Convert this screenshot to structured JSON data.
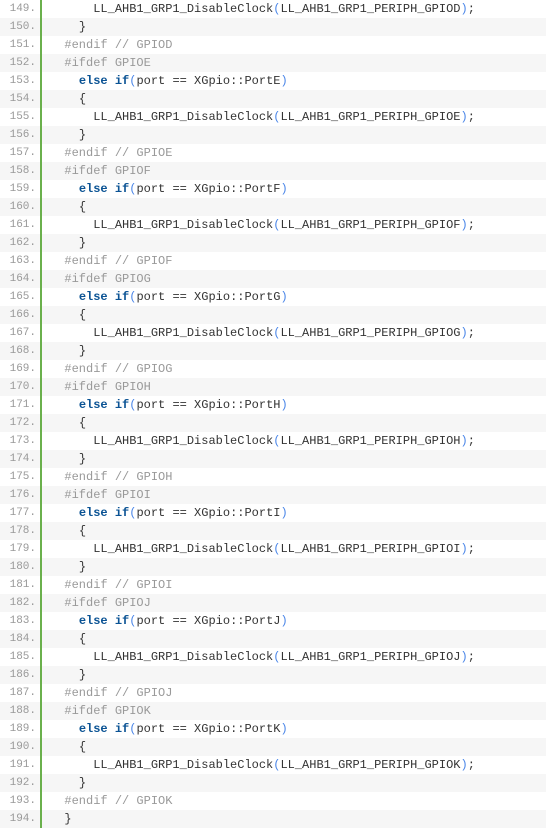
{
  "lines": [
    {
      "num": "149.",
      "indent": "      ",
      "tokens": [
        {
          "t": "func",
          "s": "LL_AHB1_GRP1_DisableClock"
        },
        {
          "t": "paren",
          "s": "("
        },
        {
          "t": "ident",
          "s": "LL_AHB1_GRP1_PERIPH_GPIOD"
        },
        {
          "t": "paren",
          "s": ")"
        },
        {
          "t": "op",
          "s": ";"
        }
      ]
    },
    {
      "num": "150.",
      "indent": "    ",
      "tokens": [
        {
          "t": "brace",
          "s": "}"
        }
      ]
    },
    {
      "num": "151.",
      "indent": "  ",
      "tokens": [
        {
          "t": "preproc",
          "s": "#endif "
        },
        {
          "t": "comment",
          "s": "// GPIOD"
        }
      ]
    },
    {
      "num": "152.",
      "indent": "  ",
      "tokens": [
        {
          "t": "preproc",
          "s": "#ifdef GPIOE"
        }
      ]
    },
    {
      "num": "153.",
      "indent": "    ",
      "tokens": [
        {
          "t": "keyword",
          "s": "else"
        },
        {
          "t": "plain",
          "s": " "
        },
        {
          "t": "keyword",
          "s": "if"
        },
        {
          "t": "paren",
          "s": "("
        },
        {
          "t": "ident",
          "s": "port "
        },
        {
          "t": "op",
          "s": "=="
        },
        {
          "t": "ident",
          "s": " XGpio"
        },
        {
          "t": "op",
          "s": "::"
        },
        {
          "t": "ident",
          "s": "PortE"
        },
        {
          "t": "paren",
          "s": ")"
        }
      ]
    },
    {
      "num": "154.",
      "indent": "    ",
      "tokens": [
        {
          "t": "brace",
          "s": "{"
        }
      ]
    },
    {
      "num": "155.",
      "indent": "      ",
      "tokens": [
        {
          "t": "func",
          "s": "LL_AHB1_GRP1_DisableClock"
        },
        {
          "t": "paren",
          "s": "("
        },
        {
          "t": "ident",
          "s": "LL_AHB1_GRP1_PERIPH_GPIOE"
        },
        {
          "t": "paren",
          "s": ")"
        },
        {
          "t": "op",
          "s": ";"
        }
      ]
    },
    {
      "num": "156.",
      "indent": "    ",
      "tokens": [
        {
          "t": "brace",
          "s": "}"
        }
      ]
    },
    {
      "num": "157.",
      "indent": "  ",
      "tokens": [
        {
          "t": "preproc",
          "s": "#endif "
        },
        {
          "t": "comment",
          "s": "// GPIOE"
        }
      ]
    },
    {
      "num": "158.",
      "indent": "  ",
      "tokens": [
        {
          "t": "preproc",
          "s": "#ifdef GPIOF"
        }
      ]
    },
    {
      "num": "159.",
      "indent": "    ",
      "tokens": [
        {
          "t": "keyword",
          "s": "else"
        },
        {
          "t": "plain",
          "s": " "
        },
        {
          "t": "keyword",
          "s": "if"
        },
        {
          "t": "paren",
          "s": "("
        },
        {
          "t": "ident",
          "s": "port "
        },
        {
          "t": "op",
          "s": "=="
        },
        {
          "t": "ident",
          "s": " XGpio"
        },
        {
          "t": "op",
          "s": "::"
        },
        {
          "t": "ident",
          "s": "PortF"
        },
        {
          "t": "paren",
          "s": ")"
        }
      ]
    },
    {
      "num": "160.",
      "indent": "    ",
      "tokens": [
        {
          "t": "brace",
          "s": "{"
        }
      ]
    },
    {
      "num": "161.",
      "indent": "      ",
      "tokens": [
        {
          "t": "func",
          "s": "LL_AHB1_GRP1_DisableClock"
        },
        {
          "t": "paren",
          "s": "("
        },
        {
          "t": "ident",
          "s": "LL_AHB1_GRP1_PERIPH_GPIOF"
        },
        {
          "t": "paren",
          "s": ")"
        },
        {
          "t": "op",
          "s": ";"
        }
      ]
    },
    {
      "num": "162.",
      "indent": "    ",
      "tokens": [
        {
          "t": "brace",
          "s": "}"
        }
      ]
    },
    {
      "num": "163.",
      "indent": "  ",
      "tokens": [
        {
          "t": "preproc",
          "s": "#endif "
        },
        {
          "t": "comment",
          "s": "// GPIOF"
        }
      ]
    },
    {
      "num": "164.",
      "indent": "  ",
      "tokens": [
        {
          "t": "preproc",
          "s": "#ifdef GPIOG"
        }
      ]
    },
    {
      "num": "165.",
      "indent": "    ",
      "tokens": [
        {
          "t": "keyword",
          "s": "else"
        },
        {
          "t": "plain",
          "s": " "
        },
        {
          "t": "keyword",
          "s": "if"
        },
        {
          "t": "paren",
          "s": "("
        },
        {
          "t": "ident",
          "s": "port "
        },
        {
          "t": "op",
          "s": "=="
        },
        {
          "t": "ident",
          "s": " XGpio"
        },
        {
          "t": "op",
          "s": "::"
        },
        {
          "t": "ident",
          "s": "PortG"
        },
        {
          "t": "paren",
          "s": ")"
        }
      ]
    },
    {
      "num": "166.",
      "indent": "    ",
      "tokens": [
        {
          "t": "brace",
          "s": "{"
        }
      ]
    },
    {
      "num": "167.",
      "indent": "      ",
      "tokens": [
        {
          "t": "func",
          "s": "LL_AHB1_GRP1_DisableClock"
        },
        {
          "t": "paren",
          "s": "("
        },
        {
          "t": "ident",
          "s": "LL_AHB1_GRP1_PERIPH_GPIOG"
        },
        {
          "t": "paren",
          "s": ")"
        },
        {
          "t": "op",
          "s": ";"
        }
      ]
    },
    {
      "num": "168.",
      "indent": "    ",
      "tokens": [
        {
          "t": "brace",
          "s": "}"
        }
      ]
    },
    {
      "num": "169.",
      "indent": "  ",
      "tokens": [
        {
          "t": "preproc",
          "s": "#endif "
        },
        {
          "t": "comment",
          "s": "// GPIOG"
        }
      ]
    },
    {
      "num": "170.",
      "indent": "  ",
      "tokens": [
        {
          "t": "preproc",
          "s": "#ifdef GPIOH"
        }
      ]
    },
    {
      "num": "171.",
      "indent": "    ",
      "tokens": [
        {
          "t": "keyword",
          "s": "else"
        },
        {
          "t": "plain",
          "s": " "
        },
        {
          "t": "keyword",
          "s": "if"
        },
        {
          "t": "paren",
          "s": "("
        },
        {
          "t": "ident",
          "s": "port "
        },
        {
          "t": "op",
          "s": "=="
        },
        {
          "t": "ident",
          "s": " XGpio"
        },
        {
          "t": "op",
          "s": "::"
        },
        {
          "t": "ident",
          "s": "PortH"
        },
        {
          "t": "paren",
          "s": ")"
        }
      ]
    },
    {
      "num": "172.",
      "indent": "    ",
      "tokens": [
        {
          "t": "brace",
          "s": "{"
        }
      ]
    },
    {
      "num": "173.",
      "indent": "      ",
      "tokens": [
        {
          "t": "func",
          "s": "LL_AHB1_GRP1_DisableClock"
        },
        {
          "t": "paren",
          "s": "("
        },
        {
          "t": "ident",
          "s": "LL_AHB1_GRP1_PERIPH_GPIOH"
        },
        {
          "t": "paren",
          "s": ")"
        },
        {
          "t": "op",
          "s": ";"
        }
      ]
    },
    {
      "num": "174.",
      "indent": "    ",
      "tokens": [
        {
          "t": "brace",
          "s": "}"
        }
      ]
    },
    {
      "num": "175.",
      "indent": "  ",
      "tokens": [
        {
          "t": "preproc",
          "s": "#endif "
        },
        {
          "t": "comment",
          "s": "// GPIOH"
        }
      ]
    },
    {
      "num": "176.",
      "indent": "  ",
      "tokens": [
        {
          "t": "preproc",
          "s": "#ifdef GPIOI"
        }
      ]
    },
    {
      "num": "177.",
      "indent": "    ",
      "tokens": [
        {
          "t": "keyword",
          "s": "else"
        },
        {
          "t": "plain",
          "s": " "
        },
        {
          "t": "keyword",
          "s": "if"
        },
        {
          "t": "paren",
          "s": "("
        },
        {
          "t": "ident",
          "s": "port "
        },
        {
          "t": "op",
          "s": "=="
        },
        {
          "t": "ident",
          "s": " XGpio"
        },
        {
          "t": "op",
          "s": "::"
        },
        {
          "t": "ident",
          "s": "PortI"
        },
        {
          "t": "paren",
          "s": ")"
        }
      ]
    },
    {
      "num": "178.",
      "indent": "    ",
      "tokens": [
        {
          "t": "brace",
          "s": "{"
        }
      ]
    },
    {
      "num": "179.",
      "indent": "      ",
      "tokens": [
        {
          "t": "func",
          "s": "LL_AHB1_GRP1_DisableClock"
        },
        {
          "t": "paren",
          "s": "("
        },
        {
          "t": "ident",
          "s": "LL_AHB1_GRP1_PERIPH_GPIOI"
        },
        {
          "t": "paren",
          "s": ")"
        },
        {
          "t": "op",
          "s": ";"
        }
      ]
    },
    {
      "num": "180.",
      "indent": "    ",
      "tokens": [
        {
          "t": "brace",
          "s": "}"
        }
      ]
    },
    {
      "num": "181.",
      "indent": "  ",
      "tokens": [
        {
          "t": "preproc",
          "s": "#endif "
        },
        {
          "t": "comment",
          "s": "// GPIOI"
        }
      ]
    },
    {
      "num": "182.",
      "indent": "  ",
      "tokens": [
        {
          "t": "preproc",
          "s": "#ifdef GPIOJ"
        }
      ]
    },
    {
      "num": "183.",
      "indent": "    ",
      "tokens": [
        {
          "t": "keyword",
          "s": "else"
        },
        {
          "t": "plain",
          "s": " "
        },
        {
          "t": "keyword",
          "s": "if"
        },
        {
          "t": "paren",
          "s": "("
        },
        {
          "t": "ident",
          "s": "port "
        },
        {
          "t": "op",
          "s": "=="
        },
        {
          "t": "ident",
          "s": " XGpio"
        },
        {
          "t": "op",
          "s": "::"
        },
        {
          "t": "ident",
          "s": "PortJ"
        },
        {
          "t": "paren",
          "s": ")"
        }
      ]
    },
    {
      "num": "184.",
      "indent": "    ",
      "tokens": [
        {
          "t": "brace",
          "s": "{"
        }
      ]
    },
    {
      "num": "185.",
      "indent": "      ",
      "tokens": [
        {
          "t": "func",
          "s": "LL_AHB1_GRP1_DisableClock"
        },
        {
          "t": "paren",
          "s": "("
        },
        {
          "t": "ident",
          "s": "LL_AHB1_GRP1_PERIPH_GPIOJ"
        },
        {
          "t": "paren",
          "s": ")"
        },
        {
          "t": "op",
          "s": ";"
        }
      ]
    },
    {
      "num": "186.",
      "indent": "    ",
      "tokens": [
        {
          "t": "brace",
          "s": "}"
        }
      ]
    },
    {
      "num": "187.",
      "indent": "  ",
      "tokens": [
        {
          "t": "preproc",
          "s": "#endif "
        },
        {
          "t": "comment",
          "s": "// GPIOJ"
        }
      ]
    },
    {
      "num": "188.",
      "indent": "  ",
      "tokens": [
        {
          "t": "preproc",
          "s": "#ifdef GPIOK"
        }
      ]
    },
    {
      "num": "189.",
      "indent": "    ",
      "tokens": [
        {
          "t": "keyword",
          "s": "else"
        },
        {
          "t": "plain",
          "s": " "
        },
        {
          "t": "keyword",
          "s": "if"
        },
        {
          "t": "paren",
          "s": "("
        },
        {
          "t": "ident",
          "s": "port "
        },
        {
          "t": "op",
          "s": "=="
        },
        {
          "t": "ident",
          "s": " XGpio"
        },
        {
          "t": "op",
          "s": "::"
        },
        {
          "t": "ident",
          "s": "PortK"
        },
        {
          "t": "paren",
          "s": ")"
        }
      ]
    },
    {
      "num": "190.",
      "indent": "    ",
      "tokens": [
        {
          "t": "brace",
          "s": "{"
        }
      ]
    },
    {
      "num": "191.",
      "indent": "      ",
      "tokens": [
        {
          "t": "func",
          "s": "LL_AHB1_GRP1_DisableClock"
        },
        {
          "t": "paren",
          "s": "("
        },
        {
          "t": "ident",
          "s": "LL_AHB1_GRP1_PERIPH_GPIOK"
        },
        {
          "t": "paren",
          "s": ")"
        },
        {
          "t": "op",
          "s": ";"
        }
      ]
    },
    {
      "num": "192.",
      "indent": "    ",
      "tokens": [
        {
          "t": "brace",
          "s": "}"
        }
      ]
    },
    {
      "num": "193.",
      "indent": "  ",
      "tokens": [
        {
          "t": "preproc",
          "s": "#endif "
        },
        {
          "t": "comment",
          "s": "// GPIOK"
        }
      ]
    },
    {
      "num": "194.",
      "indent": "  ",
      "tokens": [
        {
          "t": "brace",
          "s": "}"
        }
      ]
    }
  ]
}
